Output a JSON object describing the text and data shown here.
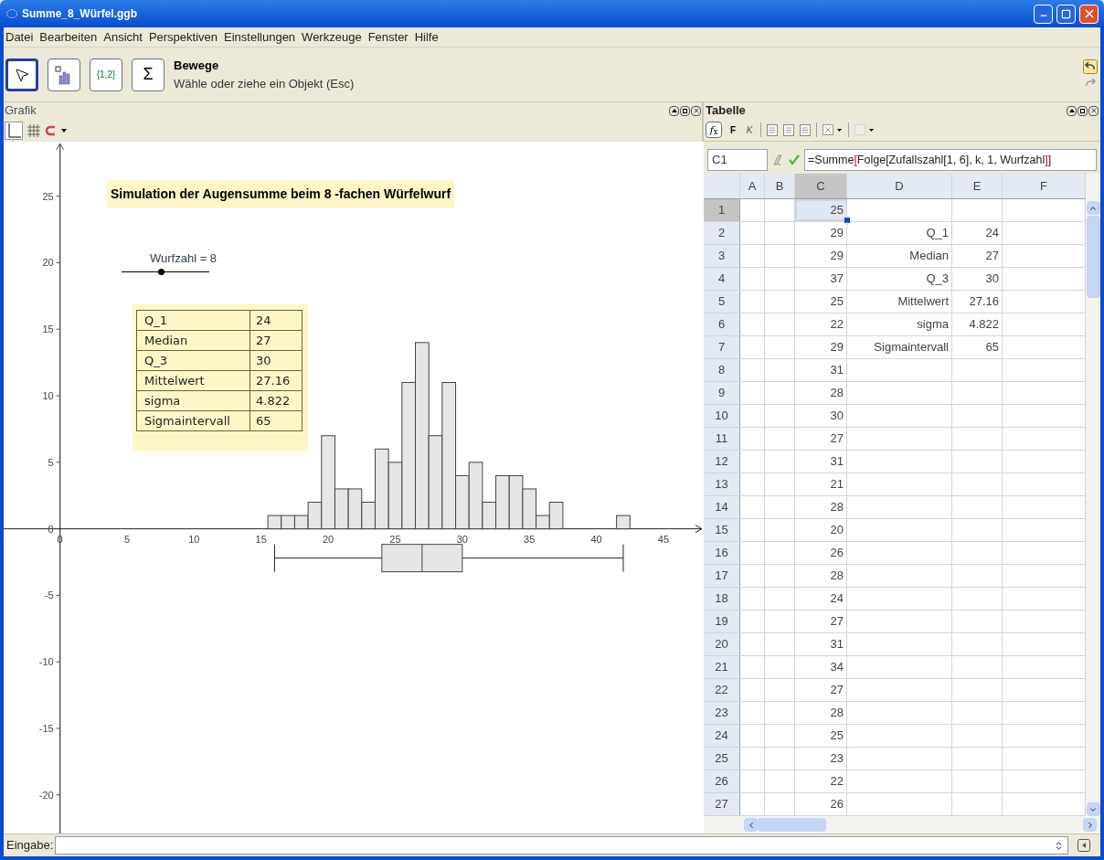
{
  "window": {
    "title": "Summe_8_Würfel.ggb"
  },
  "menu": [
    "Datei",
    "Bearbeiten",
    "Ansicht",
    "Perspektiven",
    "Einstellungen",
    "Werkzeuge",
    "Fenster",
    "Hilfe"
  ],
  "toolbar": {
    "tools": [
      {
        "kind": "move",
        "selected": true
      },
      {
        "kind": "chart",
        "selected": false
      },
      {
        "kind": "label",
        "label": "{1,2}",
        "selected": false
      },
      {
        "kind": "label",
        "label": "Σ",
        "selected": false
      }
    ],
    "tool_name": "Bewege",
    "tool_help": "Wähle oder ziehe ein Objekt (Esc)"
  },
  "graphics": {
    "title": "Grafik",
    "heading": "Simulation der Augensumme beim 8 -fachen Würfelwurf",
    "slider": {
      "label": "Wurfzahl = 8",
      "level": 0.45
    },
    "stats": [
      {
        "label": "Q_1",
        "value": "24"
      },
      {
        "label": "Median",
        "value": "27"
      },
      {
        "label": "Q_3",
        "value": "30"
      },
      {
        "label": "Mittelwert",
        "value": "27.16"
      },
      {
        "label": "sigma",
        "value": "4.822"
      },
      {
        "label": "Sigmaintervall",
        "value": "65"
      }
    ],
    "chart_data": {
      "type": "bar",
      "x": [
        16,
        17,
        18,
        19,
        20,
        21,
        22,
        23,
        24,
        25,
        26,
        27,
        28,
        29,
        30,
        31,
        32,
        33,
        34,
        35,
        36,
        37,
        38,
        39,
        40,
        41,
        42
      ],
      "values": [
        1,
        1,
        1,
        2,
        7,
        3,
        3,
        2,
        6,
        5,
        11,
        14,
        7,
        11,
        4,
        5,
        2,
        4,
        4,
        3,
        1,
        2,
        0,
        0,
        0,
        0,
        1
      ],
      "xlim": [
        -4.2,
        48
      ],
      "ylim": [
        -22.9,
        29.1
      ],
      "xticks": [
        0,
        5,
        10,
        15,
        20,
        25,
        30,
        35,
        40,
        45
      ],
      "yticks": [
        -20,
        -15,
        -10,
        -5,
        0,
        5,
        10,
        15,
        20,
        25
      ]
    }
  },
  "spreadsheet": {
    "title": "Tabelle",
    "function_button": "*f*$_{x}$",
    "format_buttons": [
      {
        "label": "F",
        "kind": "bold"
      },
      {
        "label": "K",
        "kind": "italic"
      }
    ],
    "cell_ref": "C1",
    "formula": [
      {
        "text": "=Summe",
        "highlight": false
      },
      {
        "text": "[",
        "highlight": true
      },
      {
        "text": "Folge[Zufallszahl[1, 6], k, 1, Wurfzahl",
        "highlight": false
      },
      {
        "text": "]",
        "highlight": true
      },
      {
        "text": "]",
        "highlight": false
      }
    ],
    "columns": [
      {
        "label": "A",
        "selected": false
      },
      {
        "label": "B",
        "selected": false
      },
      {
        "label": "C",
        "selected": true
      },
      {
        "label": "D",
        "selected": false
      },
      {
        "label": "E",
        "selected": false
      },
      {
        "label": "F",
        "selected": false
      }
    ],
    "rows": [
      {
        "header": "1",
        "selected": true,
        "c": "25"
      },
      {
        "header": "2",
        "selected": false,
        "c": "29",
        "d": "Q_1",
        "e": "24"
      },
      {
        "header": "3",
        "selected": false,
        "c": "29",
        "d": "Median",
        "e": "27"
      },
      {
        "header": "4",
        "selected": false,
        "c": "37",
        "d": "Q_3",
        "e": "30"
      },
      {
        "header": "5",
        "selected": false,
        "c": "25",
        "d": "Mittelwert",
        "e": "27.16"
      },
      {
        "header": "6",
        "selected": false,
        "c": "22",
        "d": "sigma",
        "e": "4.822"
      },
      {
        "header": "7",
        "selected": false,
        "c": "29",
        "d": "Sigmaintervall",
        "e": "65"
      },
      {
        "header": "8",
        "selected": false,
        "c": "31"
      },
      {
        "header": "9",
        "selected": false,
        "c": "28"
      },
      {
        "header": "10",
        "selected": false,
        "c": "30"
      },
      {
        "header": "11",
        "selected": false,
        "c": "27"
      },
      {
        "header": "12",
        "selected": false,
        "c": "31"
      },
      {
        "header": "13",
        "selected": false,
        "c": "21"
      },
      {
        "header": "14",
        "selected": false,
        "c": "28"
      },
      {
        "header": "15",
        "selected": false,
        "c": "20"
      },
      {
        "header": "16",
        "selected": false,
        "c": "26"
      },
      {
        "header": "17",
        "selected": false,
        "c": "28"
      },
      {
        "header": "18",
        "selected": false,
        "c": "24"
      },
      {
        "header": "19",
        "selected": false,
        "c": "27"
      },
      {
        "header": "20",
        "selected": false,
        "c": "31"
      },
      {
        "header": "21",
        "selected": false,
        "c": "34"
      },
      {
        "header": "22",
        "selected": false,
        "c": "27"
      },
      {
        "header": "23",
        "selected": false,
        "c": "28"
      },
      {
        "header": "24",
        "selected": false,
        "c": "25"
      },
      {
        "header": "25",
        "selected": false,
        "c": "23"
      },
      {
        "header": "26",
        "selected": false,
        "c": "22"
      },
      {
        "header": "27",
        "selected": false,
        "c": "26"
      }
    ]
  },
  "input_bar": {
    "label": "Eingabe:"
  }
}
